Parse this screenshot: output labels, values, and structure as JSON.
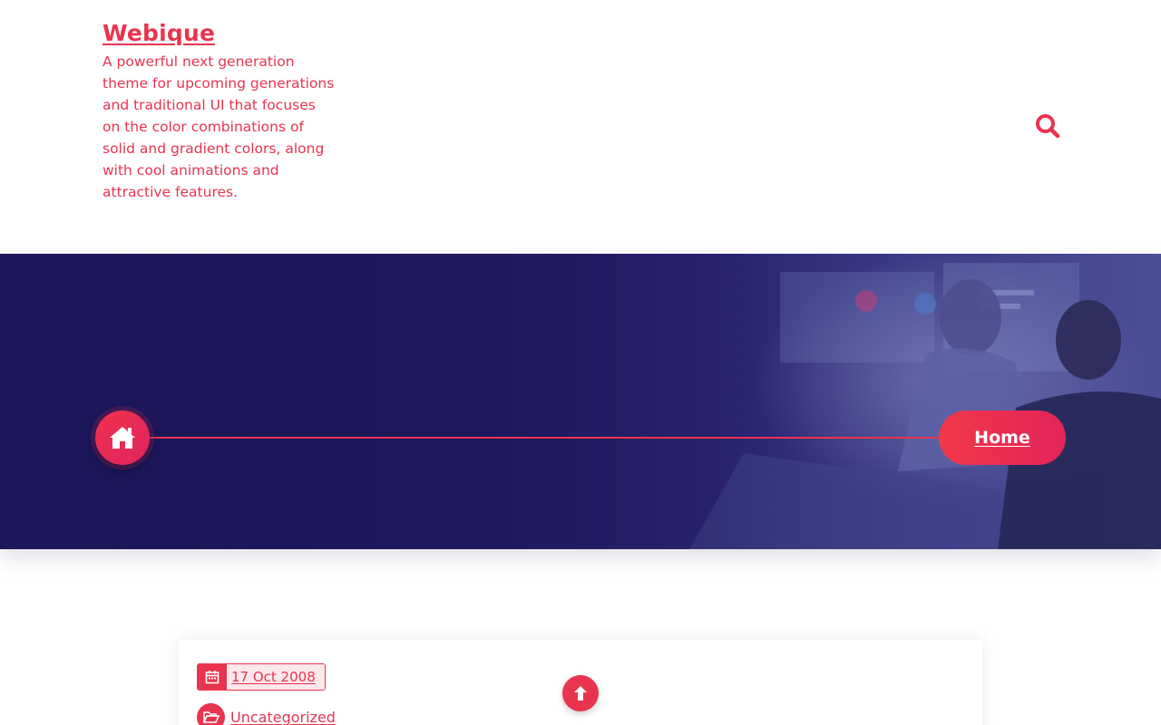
{
  "site": {
    "title": "Webique",
    "tagline": "A powerful next generation theme for upcoming generations and traditional UI that focuses on the color combinations of solid and gradient colors, along with cool animations and attractive features."
  },
  "header": {
    "search_icon": "search-icon"
  },
  "breadcrumb": {
    "home_icon": "home-icon",
    "current_label": "Home"
  },
  "post": {
    "date": "17 Oct 2008",
    "date_icon": "calendar-icon",
    "category": "Uncategorized",
    "category_icon": "folder-open-icon"
  },
  "back_to_top_icon": "arrow-up-icon",
  "colors": {
    "accent": "#e8344e",
    "hero_dark": "#1a1454",
    "background": "#ffffff"
  }
}
